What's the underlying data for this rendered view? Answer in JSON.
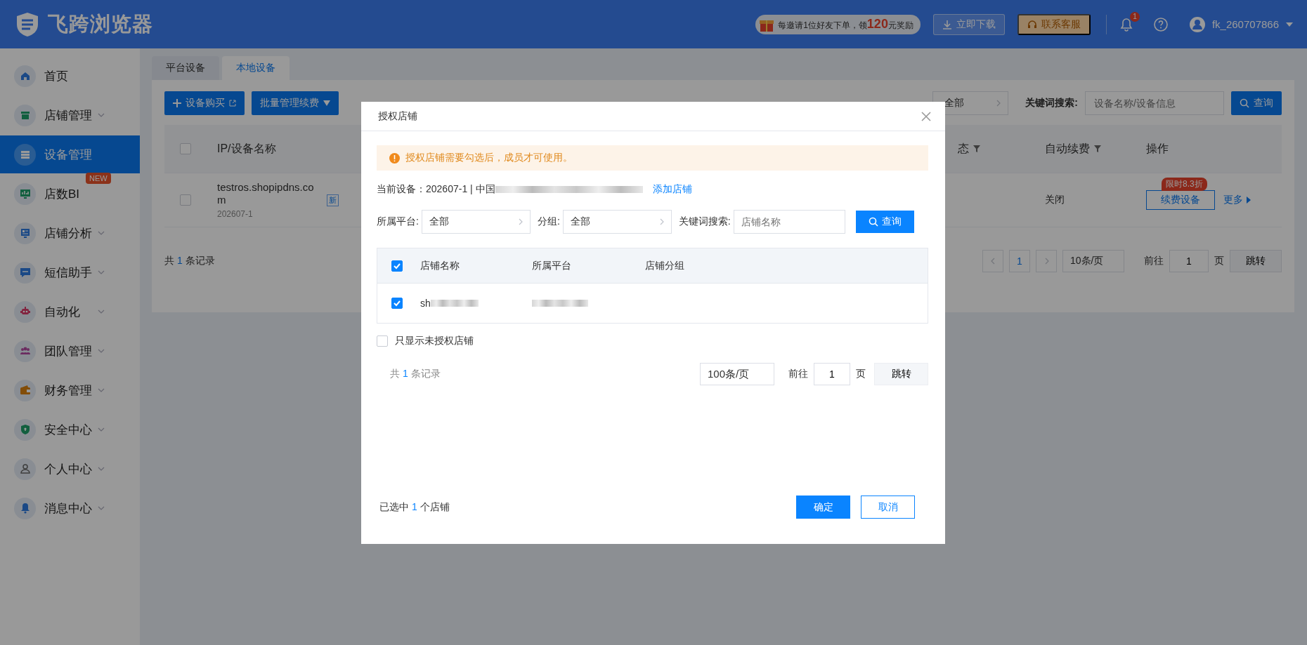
{
  "header": {
    "brand": "飞跨浏览器",
    "promo": {
      "before": "每邀请1位好友下单，领",
      "amount": "120",
      "after": "元奖励"
    },
    "download_button": "立即下载",
    "service_button": "联系客服",
    "notification_count": "1",
    "username": "fk_260707866"
  },
  "sidebar": {
    "items": [
      {
        "label": "首页",
        "expandable": false,
        "selected": false
      },
      {
        "label": "店铺管理",
        "expandable": true,
        "selected": false
      },
      {
        "label": "设备管理",
        "expandable": false,
        "selected": true
      },
      {
        "label": "店数BI",
        "expandable": false,
        "selected": false,
        "badge": "NEW"
      },
      {
        "label": "店铺分析",
        "expandable": true,
        "selected": false
      },
      {
        "label": "短信助手",
        "expandable": true,
        "selected": false
      },
      {
        "label": "自动化",
        "expandable": true,
        "selected": false
      },
      {
        "label": "团队管理",
        "expandable": true,
        "selected": false
      },
      {
        "label": "财务管理",
        "expandable": true,
        "selected": false
      },
      {
        "label": "安全中心",
        "expandable": true,
        "selected": false
      },
      {
        "label": "个人中心",
        "expandable": true,
        "selected": false
      },
      {
        "label": "消息中心",
        "expandable": true,
        "selected": false
      }
    ]
  },
  "page": {
    "tabs": [
      {
        "label": "平台设备",
        "selected": false
      },
      {
        "label": "本地设备",
        "selected": true
      }
    ],
    "toolbar": {
      "buy_button": "设备购买",
      "batch_button": "批量管理续费",
      "status_select": "全部",
      "keyword_label": "关键词搜索:",
      "keyword_placeholder": "设备名称/设备信息",
      "search_button": "查询"
    },
    "table": {
      "select_all": false,
      "columns": [
        {
          "label": "IP/设备名称",
          "filter": false
        },
        {
          "label": "态",
          "filter": true
        },
        {
          "label": "自动续费",
          "filter": true
        },
        {
          "label": "操作",
          "filter": false
        }
      ],
      "rows": [
        {
          "checked": false,
          "name": "testros.shopipdns.com",
          "tag": "新",
          "device_id": "202607-1",
          "auto_renew": "关闭",
          "action_button": "续费设备",
          "discount_badge": "限时8.3折",
          "more": "更多"
        }
      ]
    },
    "pagination": {
      "total_before": "共",
      "total": "1",
      "total_after": "条记录",
      "page": "1",
      "page_size": "10条/页",
      "goto_label": "前往",
      "goto_value": "1",
      "page_unit": "页",
      "jump_button": "跳转"
    }
  },
  "modal": {
    "title": "授权店铺",
    "alert": "授权店铺需要勾选后，成员才可使用。",
    "device_label": "当前设备：202607-1 | 中国",
    "add_link": "添加店铺",
    "filters": {
      "platform_label": "所属平台:",
      "platform_value": "全部",
      "group_label": "分组:",
      "group_value": "全部",
      "keyword_label": "关键词搜索:",
      "keyword_placeholder": "店铺名称",
      "search_button": "查询"
    },
    "table": {
      "select_all": true,
      "columns": [
        "店铺名称",
        "所属平台",
        "店铺分组"
      ],
      "rows": [
        {
          "checked": true,
          "name": "sh"
        }
      ]
    },
    "only_unauthorized": {
      "label": "只显示未授权店铺",
      "checked": false
    },
    "pagination": {
      "total_before": "共",
      "total": "1",
      "total_after": "条记录",
      "page_size": "100条/页",
      "goto_label": "前往",
      "goto_value": "1",
      "page_unit": "页",
      "jump_button": "跳转"
    },
    "selected_summary": {
      "before": "已选中",
      "count": "1",
      "after": "个店铺"
    },
    "confirm_button": "确定",
    "cancel_button": "取消"
  }
}
